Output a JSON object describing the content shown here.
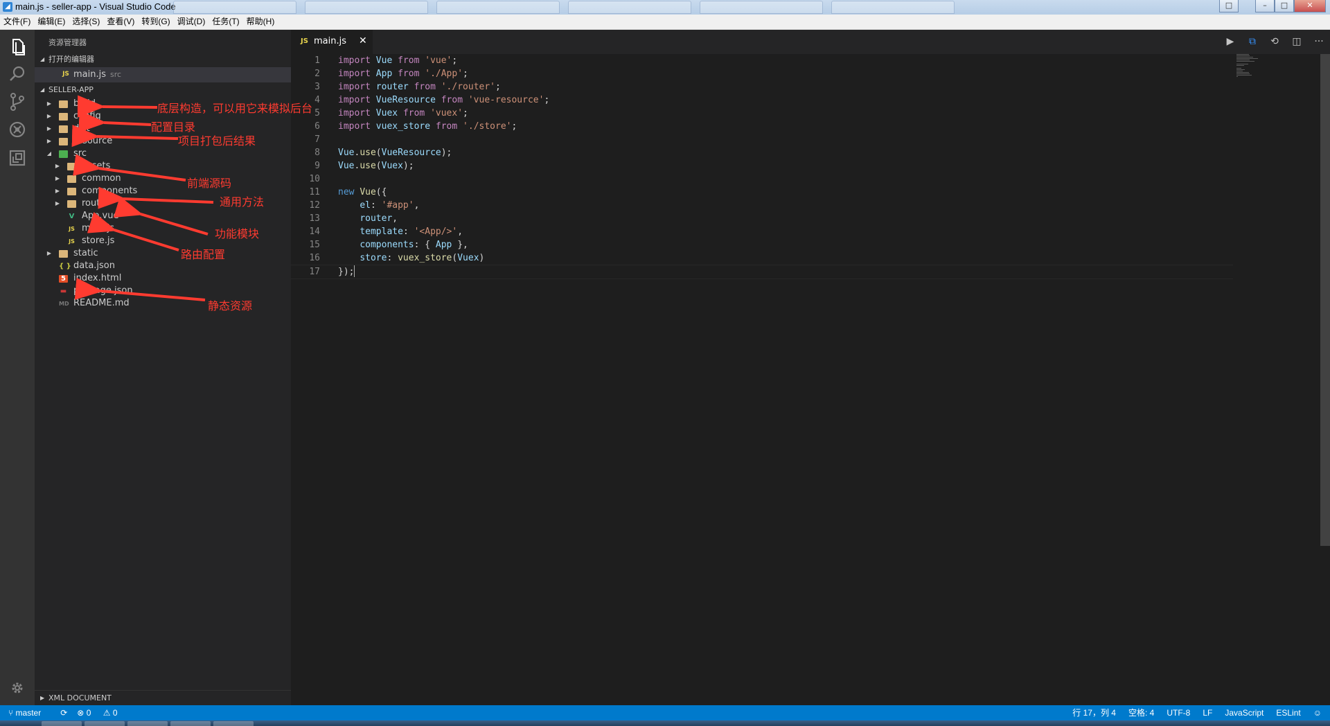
{
  "window": {
    "title": "main.js - seller-app - Visual Studio Code",
    "background_tabs": [
      "",
      "",
      "",
      "",
      "",
      ""
    ],
    "buttons": {
      "min": "–",
      "max": "□",
      "close": "✕"
    }
  },
  "menu": [
    "文件(F)",
    "编辑(E)",
    "选择(S)",
    "查看(V)",
    "转到(G)",
    "调试(D)",
    "任务(T)",
    "帮助(H)"
  ],
  "activity_bar": {
    "items": [
      "explorer-icon",
      "search-icon",
      "source-control-icon",
      "debug-icon",
      "extensions-icon"
    ],
    "settings": "gear-icon"
  },
  "sidebar": {
    "title": "资源管理器",
    "open_editors_label": "打开的编辑器",
    "open_editor": {
      "icon": "JS",
      "name": "main.js",
      "hint": "src"
    },
    "project_label": "SELLER-APP",
    "tree": [
      {
        "name": "build",
        "kind": "folder",
        "depth": 0
      },
      {
        "name": "config",
        "kind": "folder",
        "depth": 0
      },
      {
        "name": "dist",
        "kind": "folder",
        "depth": 0
      },
      {
        "name": "resource",
        "kind": "folder",
        "depth": 0
      },
      {
        "name": "src",
        "kind": "folder-open",
        "depth": 0
      },
      {
        "name": "assets",
        "kind": "folder",
        "depth": 1
      },
      {
        "name": "common",
        "kind": "folder",
        "depth": 1
      },
      {
        "name": "components",
        "kind": "folder",
        "depth": 1
      },
      {
        "name": "router",
        "kind": "folder",
        "depth": 1
      },
      {
        "name": "App.vue",
        "kind": "vue",
        "depth": 1
      },
      {
        "name": "main.js",
        "kind": "js",
        "depth": 1
      },
      {
        "name": "store.js",
        "kind": "js",
        "depth": 1
      },
      {
        "name": "static",
        "kind": "folder",
        "depth": 0
      },
      {
        "name": "data.json",
        "kind": "json",
        "depth": 0
      },
      {
        "name": "index.html",
        "kind": "html",
        "depth": 0
      },
      {
        "name": "package.json",
        "kind": "npm",
        "depth": 0
      },
      {
        "name": "README.md",
        "kind": "md",
        "depth": 0
      }
    ],
    "xml_section": "XML DOCUMENT"
  },
  "annotations": [
    "底层构造，可以用它来模拟后台",
    "配置目录",
    "项目打包后结果",
    "前端源码",
    "通用方法",
    "功能模块",
    "路由配置",
    "静态资源"
  ],
  "editor": {
    "tab": {
      "icon": "JS",
      "name": "main.js",
      "close": "✕"
    },
    "actions": [
      "▶",
      "⧉",
      "⟲",
      "◫",
      "···"
    ],
    "lines": [
      [
        [
          "k",
          "import"
        ],
        [
          "t",
          " "
        ],
        [
          "v",
          "Vue"
        ],
        [
          "t",
          " "
        ],
        [
          "k",
          "from"
        ],
        [
          "t",
          " "
        ],
        [
          "s",
          "'vue'"
        ],
        [
          "t",
          ";"
        ]
      ],
      [
        [
          "k",
          "import"
        ],
        [
          "t",
          " "
        ],
        [
          "v",
          "App"
        ],
        [
          "t",
          " "
        ],
        [
          "k",
          "from"
        ],
        [
          "t",
          " "
        ],
        [
          "s",
          "'./App'"
        ],
        [
          "t",
          ";"
        ]
      ],
      [
        [
          "k",
          "import"
        ],
        [
          "t",
          " "
        ],
        [
          "v",
          "router"
        ],
        [
          "t",
          " "
        ],
        [
          "k",
          "from"
        ],
        [
          "t",
          " "
        ],
        [
          "s",
          "'./router'"
        ],
        [
          "t",
          ";"
        ]
      ],
      [
        [
          "k",
          "import"
        ],
        [
          "t",
          " "
        ],
        [
          "v",
          "VueResource"
        ],
        [
          "t",
          " "
        ],
        [
          "k",
          "from"
        ],
        [
          "t",
          " "
        ],
        [
          "s",
          "'vue-resource'"
        ],
        [
          "t",
          ";"
        ]
      ],
      [
        [
          "k",
          "import"
        ],
        [
          "t",
          " "
        ],
        [
          "v",
          "Vuex"
        ],
        [
          "t",
          " "
        ],
        [
          "k",
          "from"
        ],
        [
          "t",
          " "
        ],
        [
          "s",
          "'vuex'"
        ],
        [
          "t",
          ";"
        ]
      ],
      [
        [
          "k",
          "import"
        ],
        [
          "t",
          " "
        ],
        [
          "v",
          "vuex_store"
        ],
        [
          "t",
          " "
        ],
        [
          "k",
          "from"
        ],
        [
          "t",
          " "
        ],
        [
          "s",
          "'./store'"
        ],
        [
          "t",
          ";"
        ]
      ],
      [],
      [
        [
          "v",
          "Vue"
        ],
        [
          "t",
          "."
        ],
        [
          "f",
          "use"
        ],
        [
          "t",
          "("
        ],
        [
          "v",
          "VueResource"
        ],
        [
          "t",
          ");"
        ]
      ],
      [
        [
          "v",
          "Vue"
        ],
        [
          "t",
          "."
        ],
        [
          "f",
          "use"
        ],
        [
          "t",
          "("
        ],
        [
          "v",
          "Vuex"
        ],
        [
          "t",
          ");"
        ]
      ],
      [],
      [
        [
          "kb",
          "new"
        ],
        [
          "t",
          " "
        ],
        [
          "f",
          "Vue"
        ],
        [
          "t",
          "({"
        ]
      ],
      [
        [
          "t",
          "    "
        ],
        [
          "v",
          "el"
        ],
        [
          "t",
          ": "
        ],
        [
          "s",
          "'#app'"
        ],
        [
          "t",
          ","
        ]
      ],
      [
        [
          "t",
          "    "
        ],
        [
          "v",
          "router"
        ],
        [
          "t",
          ","
        ]
      ],
      [
        [
          "t",
          "    "
        ],
        [
          "v",
          "template"
        ],
        [
          "t",
          ": "
        ],
        [
          "s",
          "'<App/>'"
        ],
        [
          "t",
          ","
        ]
      ],
      [
        [
          "t",
          "    "
        ],
        [
          "v",
          "components"
        ],
        [
          "t",
          ": { "
        ],
        [
          "v",
          "App"
        ],
        [
          "t",
          " },"
        ]
      ],
      [
        [
          "t",
          "    "
        ],
        [
          "v",
          "store"
        ],
        [
          "t",
          ": "
        ],
        [
          "f",
          "vuex_store"
        ],
        [
          "t",
          "("
        ],
        [
          "v",
          "Vuex"
        ],
        [
          "t",
          ")"
        ]
      ],
      [
        [
          "t",
          "});"
        ]
      ]
    ]
  },
  "status_bar": {
    "branch": "master",
    "sync": "⟳",
    "errors": "0",
    "warnings": "0",
    "position": "行 17，列 4",
    "indent": "空格: 4",
    "encoding": "UTF-8",
    "eol": "LF",
    "language": "JavaScript",
    "linter": "ESLint",
    "feedback": "☺"
  },
  "colors": {
    "accent": "#007acc",
    "annotation": "#ff3b30",
    "folder": "#dcb67a",
    "src_folder": "#4caf50",
    "js": "#e8d44d"
  }
}
